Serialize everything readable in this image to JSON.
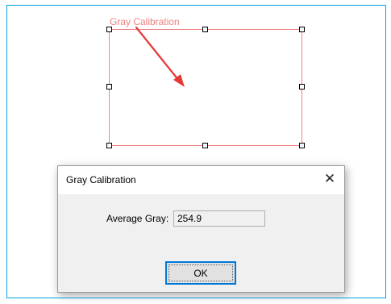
{
  "roi": {
    "label": "Gray Calibration",
    "color": "#f08080",
    "arrow_color": "#e53935"
  },
  "dialog": {
    "title": "Gray Calibration",
    "close_glyph": "✕",
    "average_gray_label": "Average Gray:",
    "average_gray_value": "254.9",
    "ok_label": "OK"
  },
  "icons": [
    "close-icon",
    "arrow-icon"
  ]
}
